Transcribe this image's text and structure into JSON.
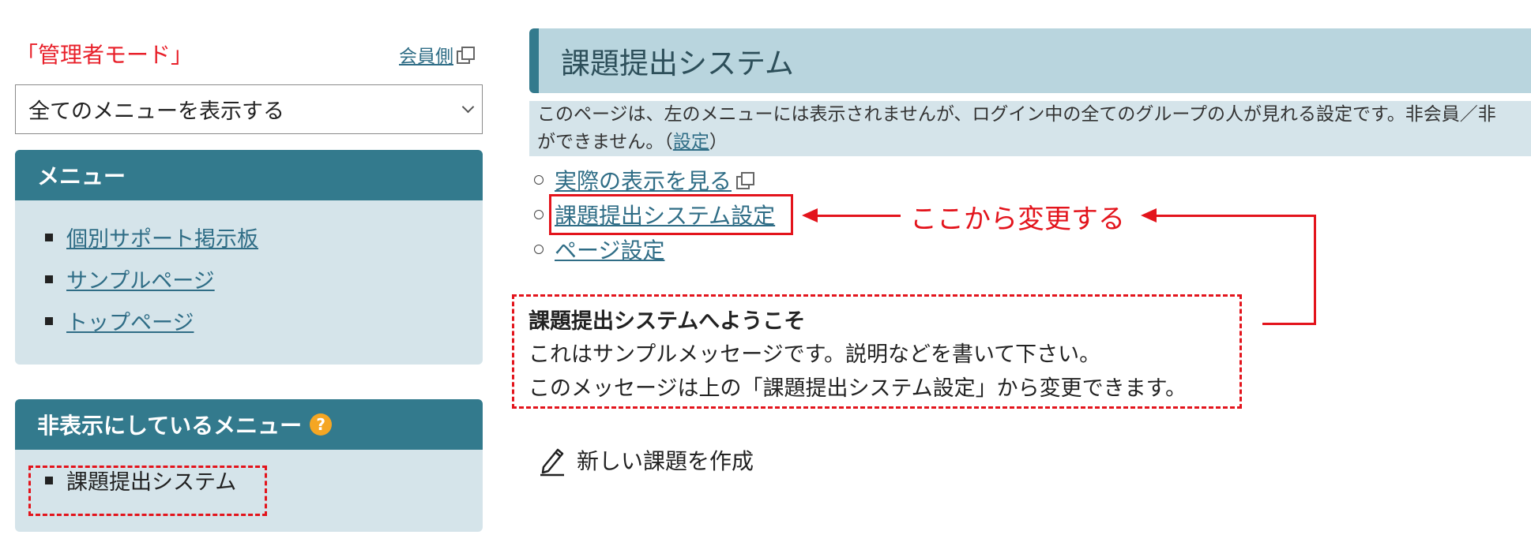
{
  "sidebar": {
    "mode_label": "「管理者モード」",
    "member_link": "会員側",
    "menu_select": {
      "selected": "全てのメニューを表示する"
    },
    "menu_panel": {
      "title": "メニュー",
      "items": [
        {
          "label": "個別サポート掲示板"
        },
        {
          "label": "サンプルページ"
        },
        {
          "label": "トップページ"
        }
      ]
    },
    "hidden_panel": {
      "title": "非表示にしているメニュー",
      "help": "?",
      "items": [
        {
          "label": "課題提出システム"
        }
      ]
    }
  },
  "main": {
    "page_title": "課題提出システム",
    "notice": {
      "line1": "このページは、左のメニューには表示されませんが、ログイン中の全てのグループの人が見れる設定です。非会員／非",
      "line2_prefix": "ができません。（",
      "line2_link": "設定",
      "line2_suffix": "）"
    },
    "actions": [
      {
        "label": "実際の表示を見る"
      },
      {
        "label": "課題提出システム設定"
      },
      {
        "label": "ページ設定"
      }
    ],
    "annotation": "ここから変更する",
    "welcome": {
      "title": "課題提出システムへようこそ",
      "line1": "これはサンプルメッセージです。説明などを書いて下さい。",
      "line2": "このメッセージは上の「課題提出システム設定」から変更できます。"
    },
    "new_task": "新しい課題を作成"
  },
  "colors": {
    "accent": "#337a8d",
    "panel_bg": "#d5e4ea",
    "title_bg": "#b9d5de",
    "link": "#2f6d86",
    "annotation_red": "#e3141c",
    "help_orange": "#f5a623"
  }
}
